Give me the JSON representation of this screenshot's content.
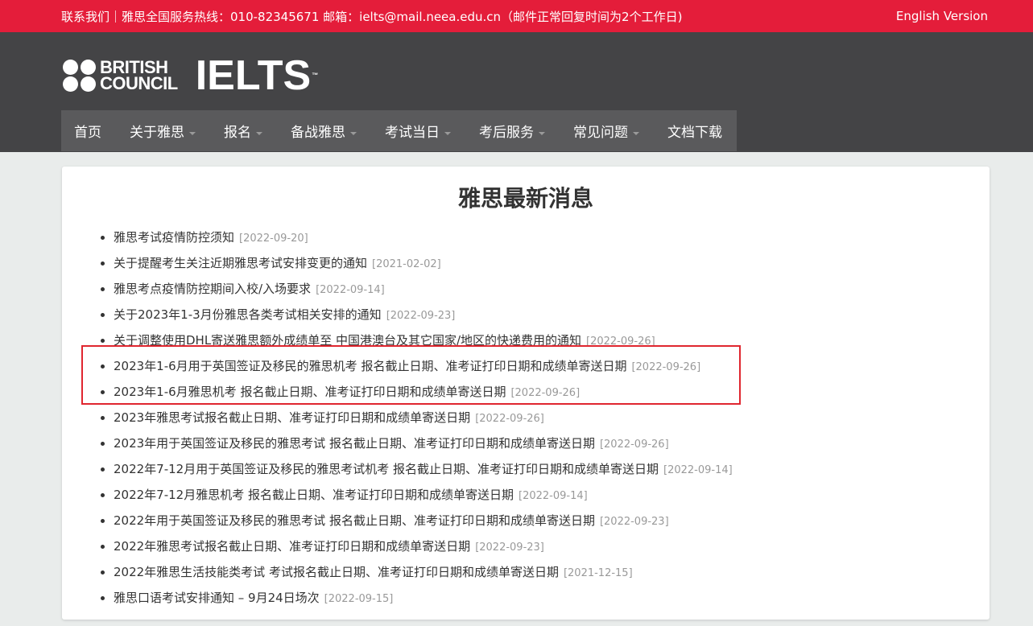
{
  "topbar": {
    "contact": "联系我们｜雅思全国服务热线：010-82345671   邮箱：ielts@mail.neea.edu.cn（邮件正常回复时间为2个工作日)",
    "english_version": "English Version"
  },
  "logo": {
    "british": "BRITISH",
    "council": "COUNCIL",
    "ielts": "IELTS",
    "tm": "™"
  },
  "nav": [
    {
      "label": "首页",
      "dropdown": false
    },
    {
      "label": "关于雅思",
      "dropdown": true
    },
    {
      "label": "报名",
      "dropdown": true
    },
    {
      "label": "备战雅思",
      "dropdown": true
    },
    {
      "label": "考试当日",
      "dropdown": true
    },
    {
      "label": "考后服务",
      "dropdown": true
    },
    {
      "label": "常见问题",
      "dropdown": true
    },
    {
      "label": "文档下载",
      "dropdown": false
    }
  ],
  "main": {
    "title": "雅思最新消息",
    "news": [
      {
        "title": "雅思考试疫情防控须知",
        "date": "[2022-09-20]"
      },
      {
        "title": "关于提醒考生关注近期雅思考试安排变更的通知",
        "date": "[2021-02-02]"
      },
      {
        "title": "雅思考点疫情防控期间入校/入场要求",
        "date": "[2022-09-14]"
      },
      {
        "title": "关于2023年1-3月份雅思各类考试相关安排的通知",
        "date": "[2022-09-23]"
      },
      {
        "title": "关于调整使用DHL寄送雅思额外成绩单至 中国港澳台及其它国家/地区的快递费用的通知",
        "date": "[2022-09-26]"
      },
      {
        "title": "2023年1-6月用于英国签证及移民的雅思机考 报名截止日期、准考证打印日期和成绩单寄送日期",
        "date": "[2022-09-26]"
      },
      {
        "title": "2023年1-6月雅思机考 报名截止日期、准考证打印日期和成绩单寄送日期",
        "date": "[2022-09-26]"
      },
      {
        "title": "2023年雅思考试报名截止日期、准考证打印日期和成绩单寄送日期",
        "date": "[2022-09-26]"
      },
      {
        "title": "2023年用于英国签证及移民的雅思考试 报名截止日期、准考证打印日期和成绩单寄送日期",
        "date": "[2022-09-26]"
      },
      {
        "title": "2022年7-12月用于英国签证及移民的雅思考试机考 报名截止日期、准考证打印日期和成绩单寄送日期",
        "date": "[2022-09-14]"
      },
      {
        "title": "2022年7-12月雅思机考 报名截止日期、准考证打印日期和成绩单寄送日期",
        "date": "[2022-09-14]"
      },
      {
        "title": "2022年用于英国签证及移民的雅思考试 报名截止日期、准考证打印日期和成绩单寄送日期",
        "date": "[2022-09-23]"
      },
      {
        "title": "2022年雅思考试报名截止日期、准考证打印日期和成绩单寄送日期",
        "date": "[2022-09-23]"
      },
      {
        "title": "2022年雅思生活技能类考试 考试报名截止日期、准考证打印日期和成绩单寄送日期",
        "date": "[2021-12-15]"
      },
      {
        "title": "雅思口语考试安排通知 – 9月24日场次",
        "date": "[2022-09-15]"
      }
    ]
  },
  "colors": {
    "topbar": "#e41d3a",
    "header": "#444446",
    "nav": "#5a5a5c",
    "highlight": "#e0262f"
  }
}
